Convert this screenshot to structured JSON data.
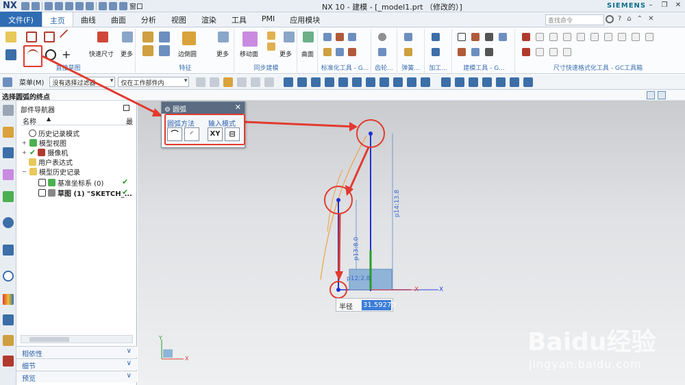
{
  "app": {
    "logo": "NX",
    "title": "NX 10 - 建模 - [_model1.prt （修改的）]",
    "brand": "SIEMENS",
    "window_label": "窗口"
  },
  "tabs": {
    "file": "文件(F)",
    "items": [
      "主页",
      "曲线",
      "曲面",
      "分析",
      "视图",
      "渲染",
      "工具",
      "PMI",
      "应用模块"
    ],
    "search_placeholder": "查找命令"
  },
  "ribbon": {
    "groups": [
      {
        "label": "直接草图",
        "buttons": [
          "快速尺寸",
          "更多"
        ]
      },
      {
        "label": "特征",
        "buttons": [
          "边倒圆",
          "更多"
        ]
      },
      {
        "label": "同步建模",
        "buttons": [
          "移动面",
          "更多"
        ]
      },
      {
        "label": "",
        "buttons": [
          "曲面"
        ]
      },
      {
        "label": "标准化工具 - G...",
        "buttons": []
      },
      {
        "label": "齿轮...",
        "buttons": []
      },
      {
        "label": "弹簧...",
        "buttons": []
      },
      {
        "label": "加工...",
        "buttons": []
      },
      {
        "label": "建模工具 - G...",
        "buttons": []
      },
      {
        "label": "尺寸快速格式化工具 - GC工具箱",
        "buttons": []
      }
    ]
  },
  "selection_bar": {
    "menu": "菜单(M)",
    "filter": "没有选择过滤器",
    "scope": "仅在工作部件内"
  },
  "prompt": "选择圆弧的终点",
  "navigator": {
    "title": "部件导航器",
    "col_name": "名称",
    "col_latest": "最",
    "rows": [
      {
        "label": "历史记录模式",
        "bold": false
      },
      {
        "label": "模型视图",
        "bold": false
      },
      {
        "label": "摄像机",
        "bold": false
      },
      {
        "label": "用户表达式",
        "bold": false
      },
      {
        "label": "模型历史记录",
        "bold": false
      },
      {
        "label": "基准坐标系 (0)",
        "bold": false
      },
      {
        "label": "草图 (1) \"SKETCH_...",
        "bold": true
      }
    ],
    "panels": [
      "相依性",
      "细节",
      "预览"
    ]
  },
  "dialog": {
    "title": "圆弧",
    "method_label": "圆弧方法",
    "input_label": "输入模式",
    "xy_label": "XY"
  },
  "canvas": {
    "dims": [
      "p14:13.8",
      "p13:8.0",
      "p12:2.8"
    ],
    "axis_x": "X",
    "axis_y": "Y",
    "radius_label": "半径",
    "radius_value": "31.59270"
  },
  "watermark": {
    "brand": "Baidu经验",
    "url": "jingyan.baidu.com"
  },
  "colors": {
    "accent": "#2f6db3",
    "highlight": "#e23a2e"
  }
}
